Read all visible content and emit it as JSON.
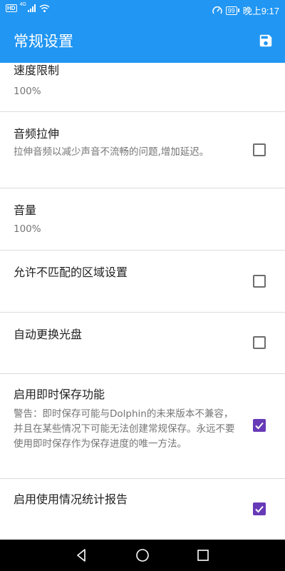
{
  "status_bar": {
    "hd_badge": "HD",
    "network": "4G",
    "battery": "99",
    "time": "晚上9:17"
  },
  "app_bar": {
    "title": "常规设置"
  },
  "settings": [
    {
      "title": "速度限制",
      "summary": "100%"
    },
    {
      "title": "音频拉伸",
      "summary": "拉伸音频以减少声音不流畅的问题,增加延迟。",
      "checked": false
    },
    {
      "title": "音量",
      "summary": "100%"
    },
    {
      "title": "允许不匹配的区域设置",
      "checked": false
    },
    {
      "title": "自动更换光盘",
      "checked": false
    },
    {
      "title": "启用即时保存功能",
      "summary": "警告：即时保存可能与Dolphin的未来版本不兼容，并且在某些情况下可能无法创建常规保存。永远不要使用即时保存作为保存进度的唯一方法。",
      "checked": true
    },
    {
      "title": "启用使用情况统计报告",
      "checked": true
    }
  ],
  "colors": {
    "primary": "#2196f3",
    "checkbox_checked": "#673ab7",
    "divider": "#dcdcdc",
    "nav_bar": "#000000"
  },
  "icons": {
    "app_bar_action": "save-icon",
    "nav": [
      "back-icon",
      "home-icon",
      "recents-icon"
    ]
  }
}
